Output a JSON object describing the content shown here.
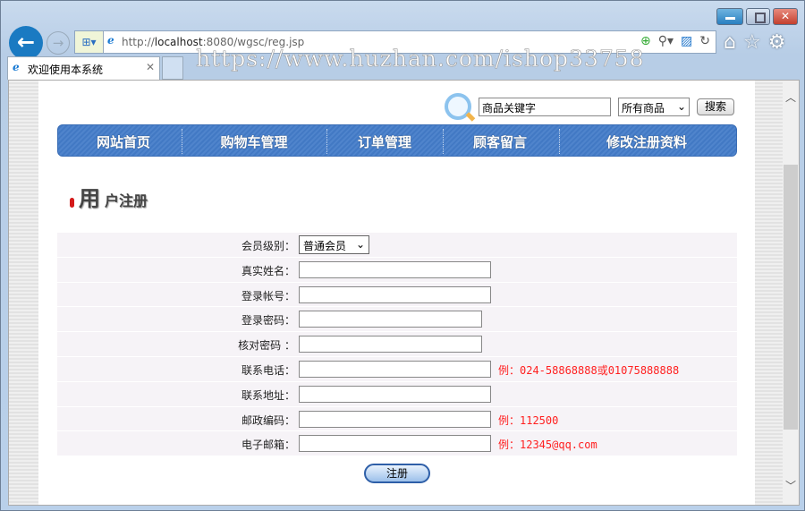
{
  "browser": {
    "url_prefix": "http://",
    "url_host": "localhost",
    "url_rest": ":8080/wgsc/reg.jsp",
    "tab_title": "欢迎使用本系统",
    "watermark": "https://www.huzhan.com/ishop33758"
  },
  "search": {
    "keyword": "商品关键字",
    "category": "所有商品",
    "button": "搜索"
  },
  "nav": [
    "网站首页",
    "购物车管理",
    "订单管理",
    "顾客留言",
    "修改注册资料"
  ],
  "title": {
    "big": "用",
    "rest": "户注册"
  },
  "form": {
    "level_label": "会员级别：",
    "level_value": "普通会员",
    "rows": [
      {
        "label": "真实姓名：",
        "hint": ""
      },
      {
        "label": "登录帐号：",
        "hint": ""
      },
      {
        "label": "登录密码：",
        "hint": ""
      },
      {
        "label": "核对密码 ：",
        "hint": ""
      },
      {
        "label": "联系电话：",
        "hint": "例：024-58868888或01075888888"
      },
      {
        "label": "联系地址：",
        "hint": ""
      },
      {
        "label": "邮政编码：",
        "hint": "例：112500"
      },
      {
        "label": "电子邮箱：",
        "hint": "例：12345@qq.com"
      }
    ],
    "submit": "注册"
  }
}
